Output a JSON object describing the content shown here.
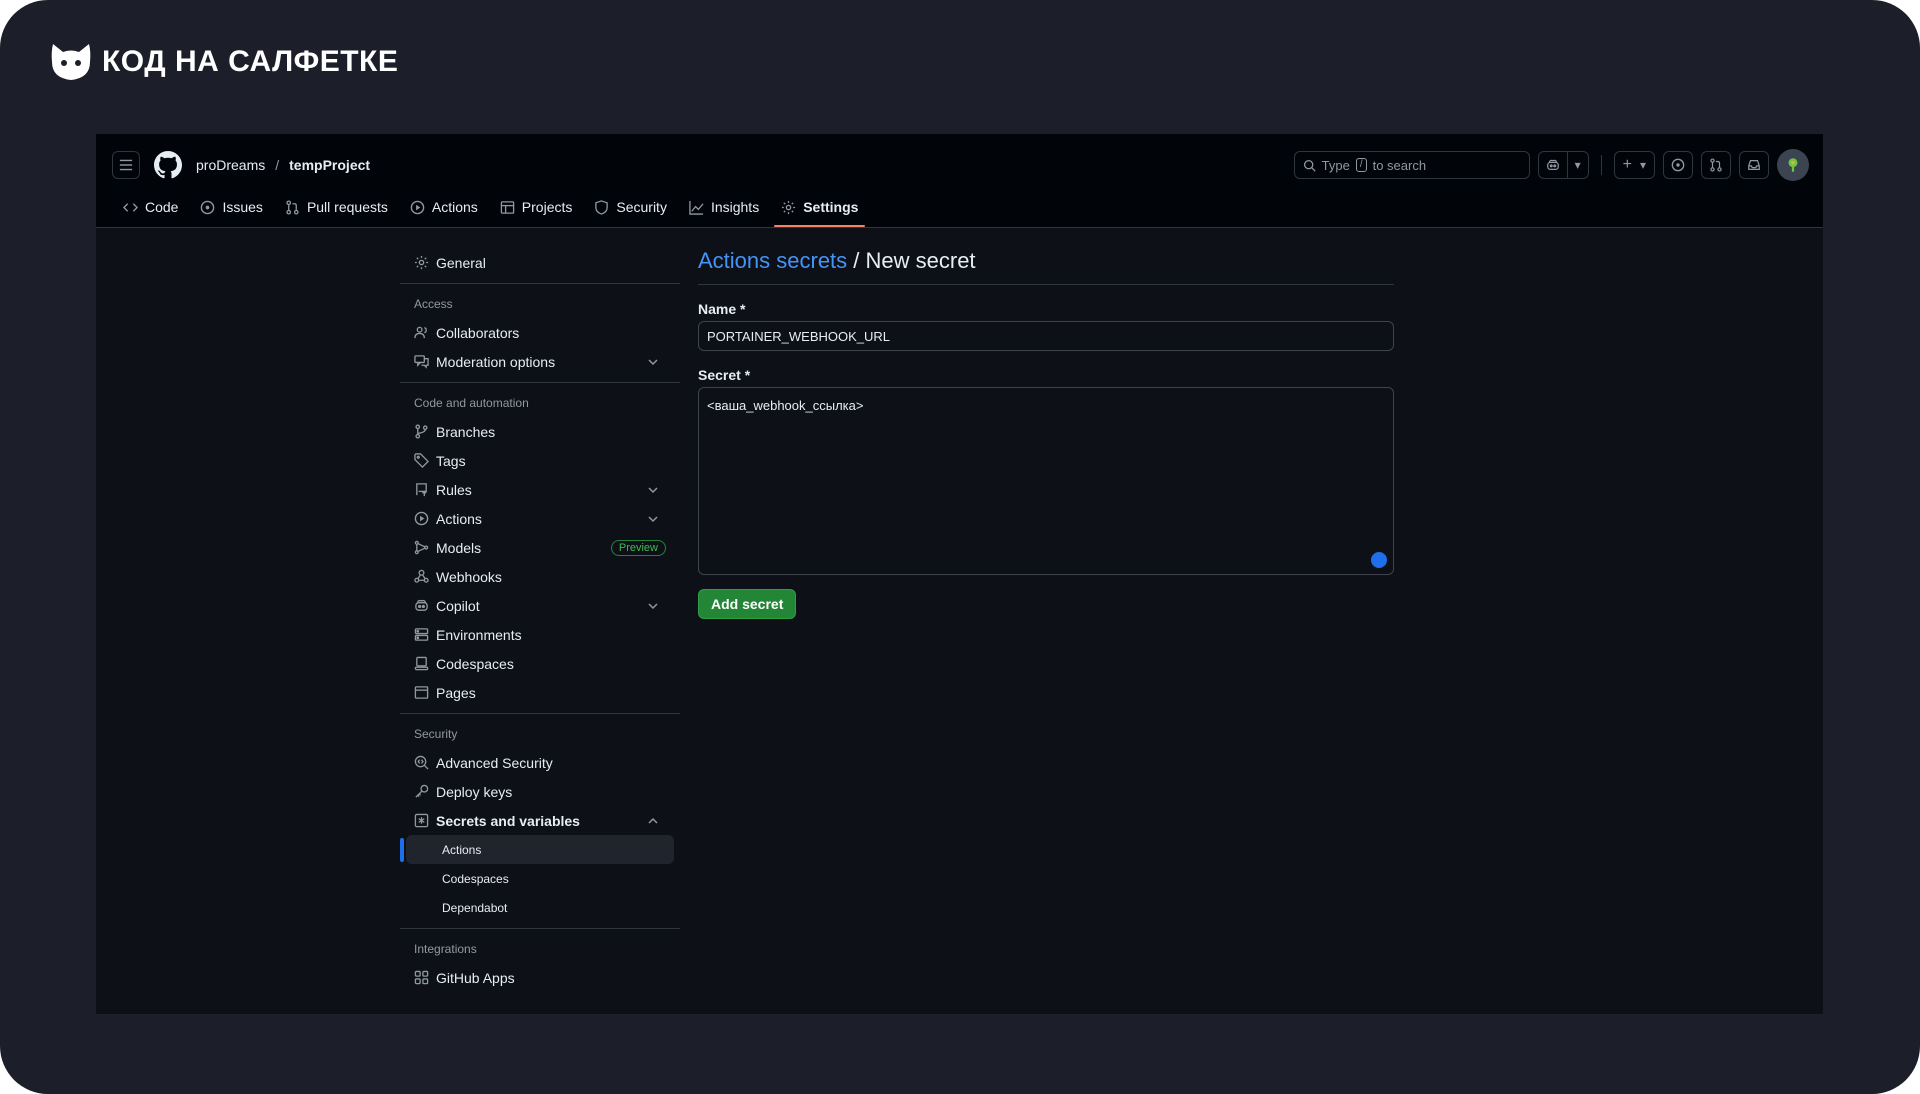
{
  "brand": {
    "text": "КОД НА САЛФЕТКЕ"
  },
  "header": {
    "owner": "proDreams",
    "separator": "/",
    "repo": "tempProject",
    "search_placeholder_prefix": "Type",
    "search_key": "/",
    "search_placeholder_suffix": "to search"
  },
  "tabs": [
    {
      "label": "Code",
      "icon": "code-icon"
    },
    {
      "label": "Issues",
      "icon": "issue-icon"
    },
    {
      "label": "Pull requests",
      "icon": "pull-request-icon"
    },
    {
      "label": "Actions",
      "icon": "play-icon"
    },
    {
      "label": "Projects",
      "icon": "table-icon"
    },
    {
      "label": "Security",
      "icon": "shield-icon"
    },
    {
      "label": "Insights",
      "icon": "graph-icon"
    },
    {
      "label": "Settings",
      "icon": "gear-icon",
      "active": true
    }
  ],
  "sidebar": {
    "general": "General",
    "access": "Access",
    "collaborators": "Collaborators",
    "moderation": "Moderation options",
    "code_automation": "Code and automation",
    "branches": "Branches",
    "tags": "Tags",
    "rules": "Rules",
    "actions": "Actions",
    "models": "Models",
    "preview": "Preview",
    "webhooks": "Webhooks",
    "copilot": "Copilot",
    "environments": "Environments",
    "codespaces": "Codespaces",
    "pages": "Pages",
    "security": "Security",
    "advanced_security": "Advanced Security",
    "deploy_keys": "Deploy keys",
    "secrets_vars": "Secrets and variables",
    "sub_actions": "Actions",
    "sub_codespaces": "Codespaces",
    "sub_dependabot": "Dependabot",
    "integrations": "Integrations",
    "github_apps": "GitHub Apps"
  },
  "main": {
    "title_link": "Actions secrets",
    "title_rest": " / New secret",
    "name_label": "Name *",
    "name_value": "PORTAINER_WEBHOOK_URL",
    "secret_label": "Secret *",
    "secret_value": "<ваша_webhook_ссылка>",
    "submit": "Add secret"
  },
  "colors": {
    "accent": "#4493f8",
    "button": "#238636",
    "tab_underline": "#f78166"
  }
}
